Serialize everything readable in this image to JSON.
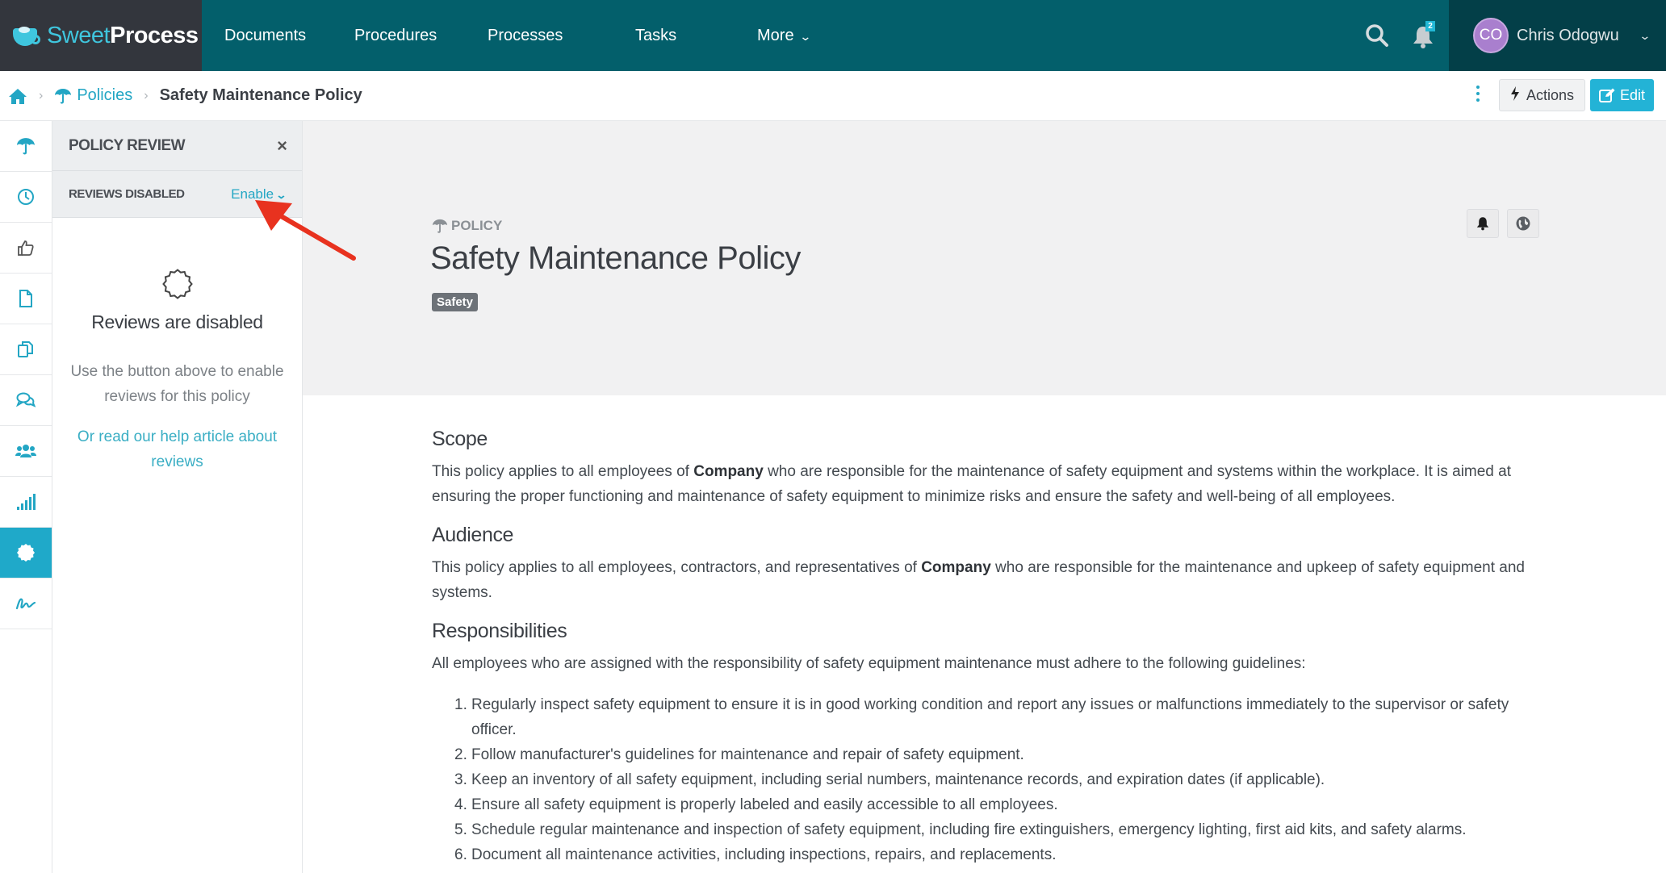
{
  "app": {
    "logo_sweet": "Sweet",
    "logo_process": "Process"
  },
  "nav": {
    "items": [
      {
        "label": "Documents"
      },
      {
        "label": "Procedures"
      },
      {
        "label": "Processes"
      },
      {
        "label": "Tasks"
      },
      {
        "label": "More"
      }
    ],
    "notifications_count": "2",
    "user": {
      "initials": "CO",
      "name": "Chris Odogwu"
    }
  },
  "breadcrumb": {
    "parent": "Policies",
    "current": "Safety Maintenance Policy",
    "separator": "›"
  },
  "toolbar": {
    "actions_label": "Actions",
    "edit_label": "Edit"
  },
  "rail": {
    "items": [
      {
        "icon": "umbrella-icon",
        "label": "Policy"
      },
      {
        "icon": "clock-icon",
        "label": "History"
      },
      {
        "icon": "thumbs-up-icon",
        "label": "Approvals"
      },
      {
        "icon": "file-icon",
        "label": "Document"
      },
      {
        "icon": "copy-icon",
        "label": "Copies"
      },
      {
        "icon": "comments-icon",
        "label": "Comments"
      },
      {
        "icon": "users-icon",
        "label": "Team"
      },
      {
        "icon": "signal-icon",
        "label": "Stats"
      },
      {
        "icon": "badge-icon",
        "label": "Reviews",
        "active": true
      },
      {
        "icon": "signature-icon",
        "label": "Signatures"
      }
    ]
  },
  "panel": {
    "title": "POLICY REVIEW",
    "close": "×",
    "status_label": "REVIEWS DISABLED",
    "enable_label": "Enable",
    "empty_title": "Reviews are disabled",
    "empty_desc": "Use the button above to enable reviews for this policy",
    "help_link": "Or read our help article about reviews"
  },
  "document": {
    "type_label": "POLICY",
    "title": "Safety Maintenance Policy",
    "tag": "Safety",
    "sections": [
      {
        "heading": "Scope",
        "text_before": "This policy applies to all employees of ",
        "bold": "Company",
        "text_after": " who are responsible for the maintenance of safety equipment and systems within the workplace. It is aimed at ensuring the proper functioning and maintenance of safety equipment to minimize risks and ensure the safety and well-being of all employees."
      },
      {
        "heading": "Audience",
        "text_before": "This policy applies to all employees, contractors, and representatives of ",
        "bold": "Company",
        "text_after": " who are responsible for the maintenance and upkeep of safety equipment and systems."
      },
      {
        "heading": "Responsibilities",
        "text": "All employees who are assigned with the responsibility of safety equipment maintenance must adhere to the following guidelines:",
        "list": [
          {
            "num": "1.",
            "text": "Regularly inspect safety equipment to ensure it is in good working condition and report any issues or malfunctions immediately to the supervisor or safety officer."
          },
          {
            "num": "2.",
            "text": "Follow manufacturer's guidelines for maintenance and repair of safety equipment."
          },
          {
            "num": "3.",
            "text": "Keep an inventory of all safety equipment, including serial numbers, maintenance records, and expiration dates (if applicable)."
          },
          {
            "num": "4.",
            "text": "Ensure all safety equipment is properly labeled and easily accessible to all employees."
          },
          {
            "num": "5.",
            "text": "Schedule regular maintenance and inspection of safety equipment, including fire extinguishers, emergency lighting, first aid kits, and safety alarms."
          },
          {
            "num": "6.",
            "text": "Document all maintenance activities, including inspections, repairs, and replacements."
          }
        ]
      }
    ]
  },
  "colors": {
    "nav_bg": "#035f6b",
    "logo_bg": "#33363d",
    "user_bg": "#033f48",
    "accent": "#23a6c4",
    "edit_button": "#23b3d6",
    "annotation_arrow": "#e8321f"
  }
}
